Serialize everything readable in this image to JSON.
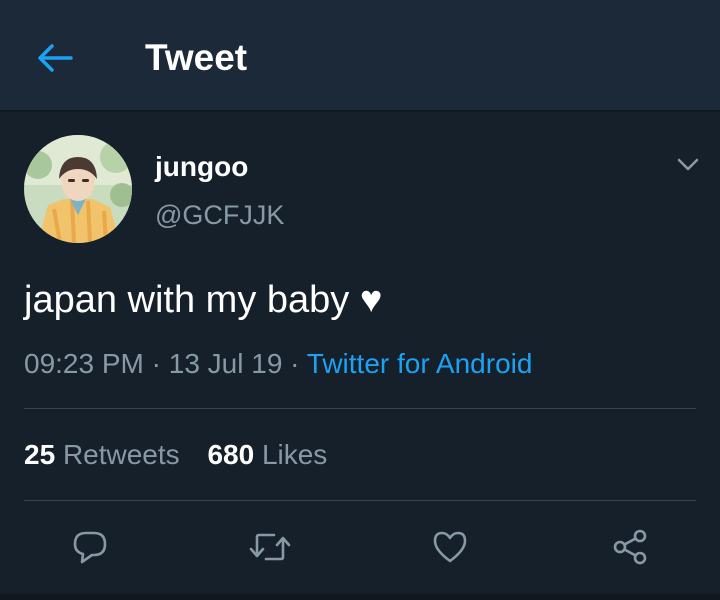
{
  "header": {
    "title": "Tweet",
    "back_icon": "arrow-left-icon"
  },
  "colors": {
    "background": "#15202b",
    "header_bg": "#1c2938",
    "accent": "#1da1f2",
    "muted": "#8899a6",
    "divider": "#38444d"
  },
  "tweet": {
    "author": {
      "display_name": "jungoo",
      "handle": "@GCFJJK"
    },
    "text": "japan with my baby ♥",
    "time": "09:23 PM",
    "date": "13 Jul 19",
    "source": "Twitter for Android",
    "sep": "·"
  },
  "stats": {
    "retweets_count": "25",
    "retweets_label": "Retweets",
    "likes_count": "680",
    "likes_label": "Likes"
  },
  "actions": [
    {
      "icon": "reply-icon"
    },
    {
      "icon": "retweet-icon"
    },
    {
      "icon": "like-icon"
    },
    {
      "icon": "share-icon"
    }
  ]
}
